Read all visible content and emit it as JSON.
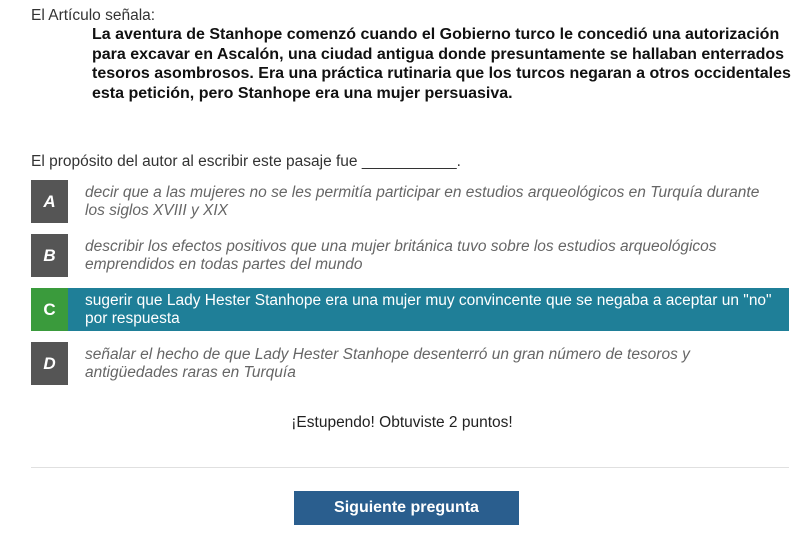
{
  "intro": "El Artículo señala:",
  "passage": "La aventura de Stanhope comenzó cuando el Gobierno turco le concedió una autorización para excavar en Ascalón, una ciudad antigua donde presuntamente se hallaban enterrados tesoros asombrosos. Era una práctica rutinaria que los turcos negaran a otros occidentales esta petición, pero Stanhope era una mujer persuasiva.",
  "question": "El propósito del autor al escribir este pasaje fue ___________.",
  "choices": [
    {
      "letter": "A",
      "text": "decir que a las mujeres no se les permitía participar en estudios arqueológicos en Turquía durante los siglos XVIII y XIX"
    },
    {
      "letter": "B",
      "text": "describir los efectos positivos que una mujer británica tuvo sobre los estudios arqueológicos emprendidos en todas partes del mundo"
    },
    {
      "letter": "C",
      "text": "sugerir que Lady Hester Stanhope era una mujer muy convincente que se negaba a aceptar un \"no\" por respuesta"
    },
    {
      "letter": "D",
      "text": "señalar el hecho de que Lady Hester Stanhope desenterró un gran número de tesoros y antigüedades raras en Turquía"
    }
  ],
  "selected_choice": "C",
  "feedback": "¡Estupendo! Obtuviste 2 puntos!",
  "next_button": "Siguiente pregunta",
  "colors": {
    "selected_bg": "#1f7f98",
    "correct_letter_bg": "#3a9b3c",
    "letter_bg": "#555555",
    "button_bg": "#2a5e8e"
  }
}
